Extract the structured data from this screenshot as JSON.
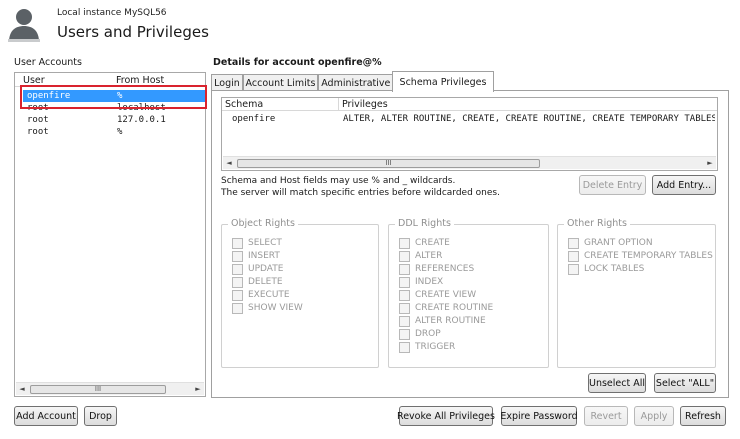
{
  "header": {
    "instance": "Local instance MySQL56",
    "title": "Users and Privileges"
  },
  "accounts": {
    "label": "User Accounts",
    "columns": [
      "User",
      "From Host"
    ],
    "rows": [
      {
        "user": "openfire",
        "host": "%",
        "selected": true
      },
      {
        "user": "root",
        "host": "localhost",
        "selected": false
      },
      {
        "user": "root",
        "host": "127.0.0.1",
        "selected": false
      },
      {
        "user": "root",
        "host": "%",
        "selected": false
      }
    ],
    "add_label": "Add Account",
    "drop_label": "Drop"
  },
  "details": {
    "title": "Details for account openfire@%",
    "tabs": [
      "Login",
      "Account Limits",
      "Administrative Roles",
      "Schema Privileges"
    ],
    "active_tab": "Schema Privileges",
    "schema_columns": [
      "Schema",
      "Privileges"
    ],
    "schema_rows": [
      {
        "schema": "openfire",
        "privileges": "ALTER, ALTER ROUTINE, CREATE, CREATE ROUTINE, CREATE TEMPORARY TABLES, CREATE"
      }
    ],
    "note_line1": "Schema and Host fields may use % and _ wildcards.",
    "note_line2": "The server will match specific entries before wildcarded ones.",
    "delete_entry_label": "Delete Entry",
    "add_entry_label": "Add Entry...",
    "object_rights": {
      "title": "Object Rights",
      "items": [
        "SELECT",
        "INSERT",
        "UPDATE",
        "DELETE",
        "EXECUTE",
        "SHOW VIEW"
      ]
    },
    "ddl_rights": {
      "title": "DDL Rights",
      "items": [
        "CREATE",
        "ALTER",
        "REFERENCES",
        "INDEX",
        "CREATE VIEW",
        "CREATE ROUTINE",
        "ALTER ROUTINE",
        "DROP",
        "TRIGGER"
      ]
    },
    "other_rights": {
      "title": "Other Rights",
      "items": [
        "GRANT OPTION",
        "CREATE TEMPORARY TABLES",
        "LOCK TABLES"
      ]
    },
    "unselect_all_label": "Unselect All",
    "select_all_label": "Select \"ALL\""
  },
  "footer": {
    "revoke_label": "Revoke All Privileges",
    "expire_label": "Expire Password",
    "revert_label": "Revert",
    "apply_label": "Apply",
    "refresh_label": "Refresh"
  },
  "scroll": {
    "left_arrow": "◄",
    "right_arrow": "►",
    "thumb_grip": "III"
  }
}
